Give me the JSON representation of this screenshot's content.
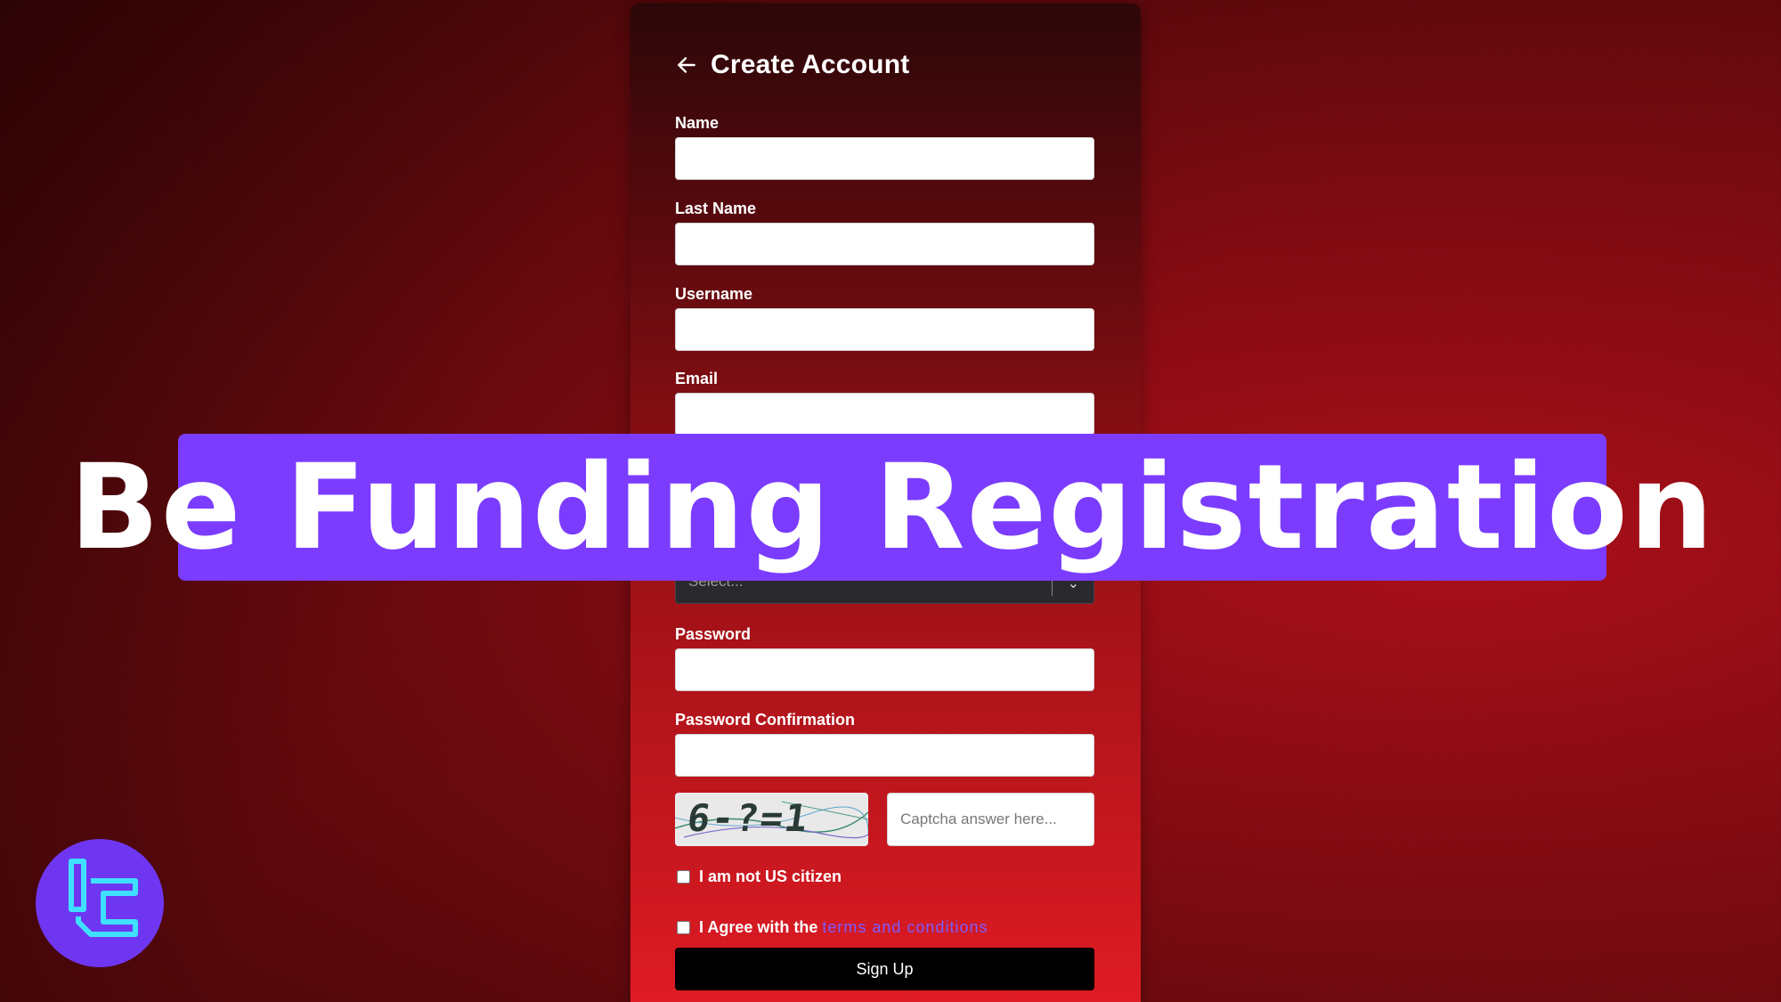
{
  "form": {
    "title": "Create Account",
    "fields": {
      "name": {
        "label": "Name",
        "value": ""
      },
      "last_name": {
        "label": "Last Name",
        "value": ""
      },
      "username": {
        "label": "Username",
        "value": ""
      },
      "email": {
        "label": "Email",
        "value": ""
      },
      "select": {
        "placeholder": "Select..."
      },
      "password": {
        "label": "Password",
        "value": ""
      },
      "password_confirmation": {
        "label": "Password Confirmation",
        "value": ""
      }
    },
    "captcha": {
      "image_text": "6-?=1",
      "input_placeholder": "Captcha answer here..."
    },
    "checkboxes": {
      "us_citizen": "I am not US citizen",
      "agree_prefix": "I Agree with the",
      "terms_link": "terms and conditions"
    },
    "submit_label": "Sign Up"
  },
  "banner": {
    "text": "Be Funding Registration"
  },
  "colors": {
    "banner": "#7b3cff",
    "link": "#7b5cff",
    "logo_bg": "#6f36f2",
    "logo_stroke": "#3fe0ff",
    "button": "#000000"
  }
}
